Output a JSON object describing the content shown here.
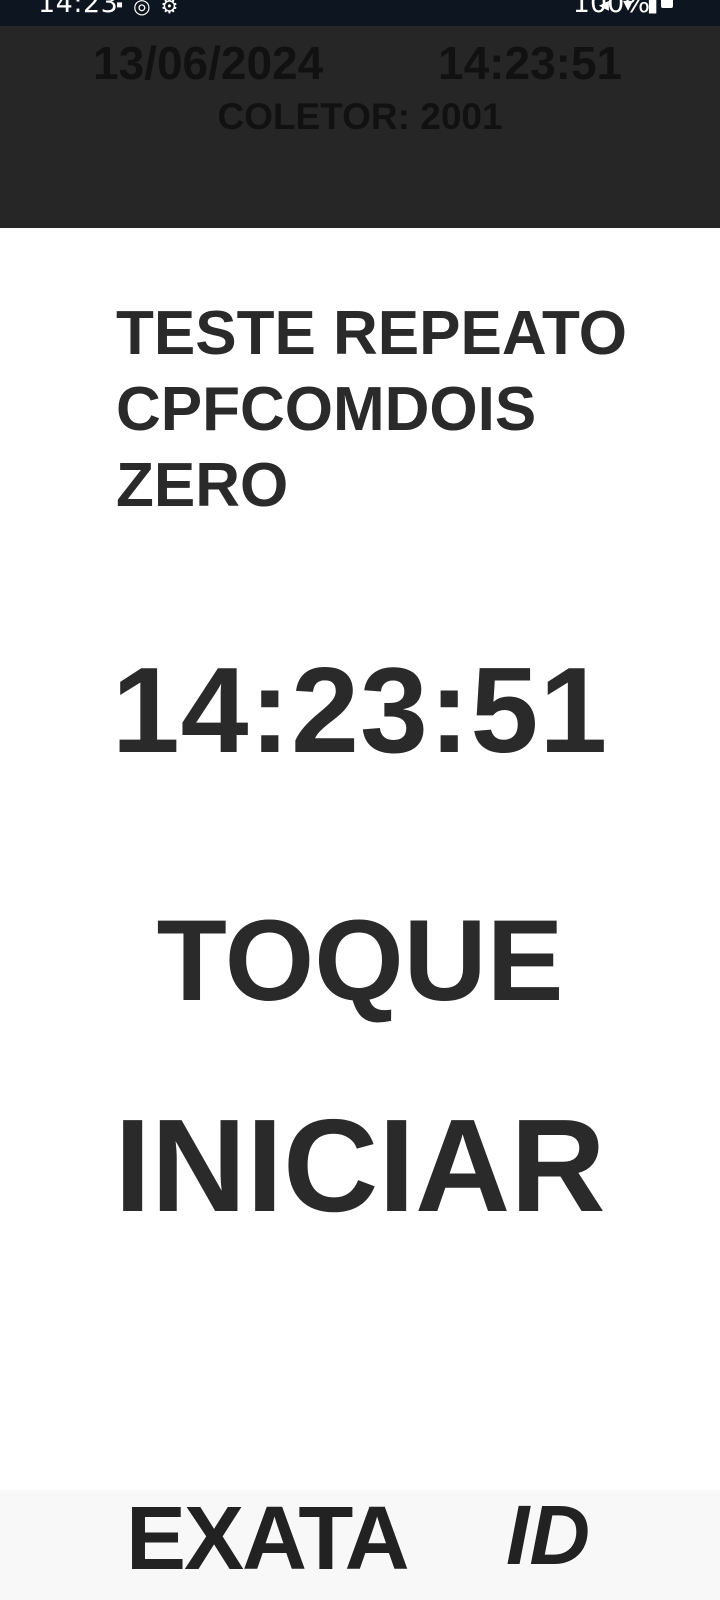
{
  "status_bar": {
    "time": "14:23",
    "left_icons": [
      "notification-icon",
      "app-icon",
      "settings-icon"
    ],
    "right_icons": [
      "mute-icon",
      "wifi-icon",
      "signal-icon"
    ],
    "battery_text": "100%"
  },
  "header": {
    "date": "13/06/2024",
    "time": "14:23:51",
    "collector": "COLETOR: 2001"
  },
  "main": {
    "employee_name": "TESTE REPEATO CPFCOMDOIS ZERO",
    "clock": "14:23:51",
    "instruction_line1": "TOQUE",
    "instruction_line2": "INICIAR"
  },
  "footer": {
    "logo_text": "EXATA",
    "logo_suffix": "ID"
  },
  "colors": {
    "status_bar_bg": "#0d1620",
    "header_bg": "#262626",
    "text_dark": "#2a2a2a"
  }
}
